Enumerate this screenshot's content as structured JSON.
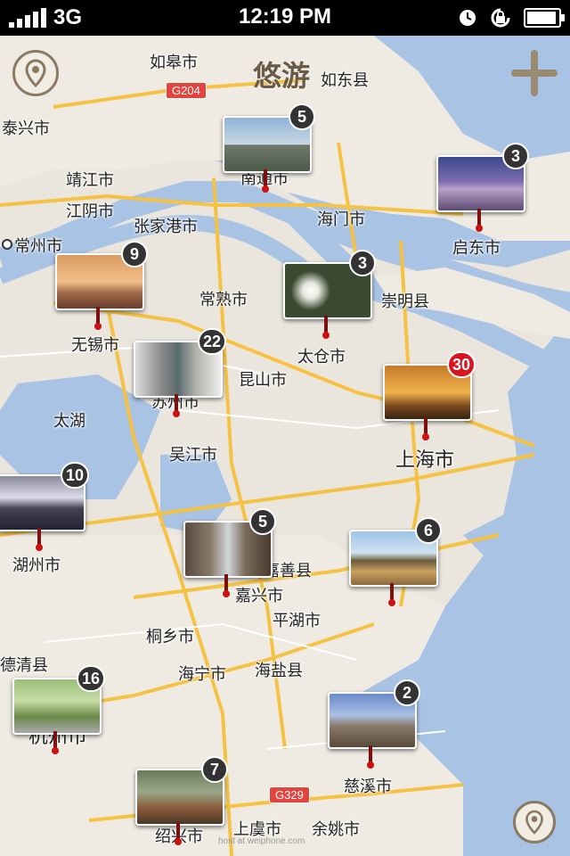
{
  "status": {
    "carrier": "3G",
    "time": "12:19 PM"
  },
  "app": {
    "title": "悠游"
  },
  "places": {
    "rugao": "如皋市",
    "rudong": "如东县",
    "g204": "G204",
    "taixing": "泰兴市",
    "nantong": "南通市",
    "jingjiang": "靖江市",
    "jiangyin": "江阴市",
    "zhangjiagang": "张家港市",
    "haimen": "海门市",
    "qidong": "启东市",
    "changzhou": "常州市",
    "changshu": "常熟市",
    "chongming": "崇明县",
    "wuxi": "无锡市",
    "taicang": "太仓市",
    "kunshan": "昆山市",
    "suzhou": "苏州市",
    "taihu": "太湖",
    "wujiang": "吴江市",
    "shanghai": "上海市",
    "huzhou": "湖州市",
    "jiashan": "嘉善县",
    "jiaxing": "嘉兴市",
    "pinghu": "平湖市",
    "tongxiang": "桐乡市",
    "haining": "海宁市",
    "haiyan": "海盐县",
    "deqing": "德清县",
    "hangzhou": "杭州市",
    "cixi": "慈溪市",
    "g329": "G329",
    "shaoxing": "绍兴市",
    "shangyu": "上虞市",
    "yuyao": "余姚市"
  },
  "pins": [
    {
      "name": "南通",
      "count": "5"
    },
    {
      "name": "启东",
      "count": "3"
    },
    {
      "name": "无锡",
      "count": "9"
    },
    {
      "name": "太仓",
      "count": "3"
    },
    {
      "name": "苏州",
      "count": "22"
    },
    {
      "name": "上海",
      "count": "30"
    },
    {
      "name": "湖州",
      "count": "10"
    },
    {
      "name": "嘉兴",
      "count": "5"
    },
    {
      "name": "平湖",
      "count": "6"
    },
    {
      "name": "杭州",
      "count": "16"
    },
    {
      "name": "慈溪",
      "count": "2"
    },
    {
      "name": "绍兴",
      "count": "7"
    }
  ],
  "watermark": "host at weiphone.com"
}
